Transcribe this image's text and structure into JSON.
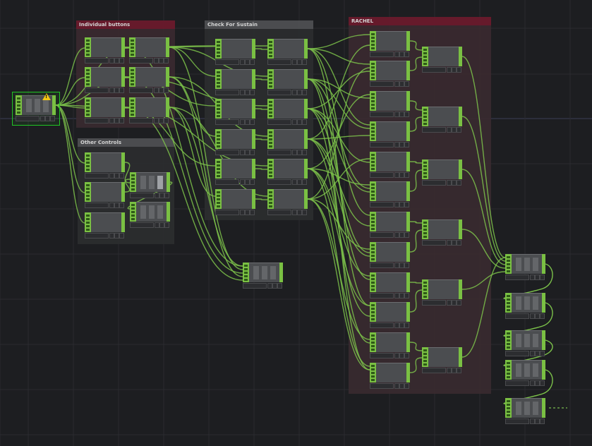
{
  "app": "TouchDesigner network editor",
  "boxes": [
    {
      "id": "individual-buttons",
      "title": "Individual buttons",
      "color": "#6e1a2d",
      "body": "#3a2a30"
    },
    {
      "id": "check-for-sustain",
      "title": "Check For Sustain",
      "color": "#505254",
      "body": "#2c2d2f"
    },
    {
      "id": "other-controls",
      "title": "Other Controls",
      "color": "#505254",
      "body": "#2c2d2f"
    },
    {
      "id": "rachel",
      "title": "RACHEL",
      "color": "#6e1a2d",
      "body": "#3a2a30"
    }
  ],
  "nodes": [
    {
      "id": "joystick1",
      "label": "joystick1",
      "value": "",
      "kind": "joystick"
    },
    {
      "id": "select3",
      "label": "select3",
      "value": "0 butt"
    },
    {
      "id": "select1",
      "label": "select1",
      "value": "0 butt"
    },
    {
      "id": "select2",
      "label": "select2",
      "value": "0 butt"
    },
    {
      "id": "select5",
      "label": "select5",
      "value": "0 butt"
    },
    {
      "id": "select4",
      "label": "select4",
      "value": "0 butt"
    },
    {
      "id": "select6",
      "label": "select6",
      "value": "0 butt"
    },
    {
      "id": "trigger1",
      "label": "trigger1",
      "value": "0 butt"
    },
    {
      "id": "trigger2",
      "label": "trigger2",
      "value": "0 butt"
    },
    {
      "id": "trigger3",
      "label": "trigger3",
      "value": "0 butt"
    },
    {
      "id": "trigger4",
      "label": "trigger4",
      "value": "0 butt"
    },
    {
      "id": "trigger5",
      "label": "trigger5",
      "value": "0 butt"
    },
    {
      "id": "trigger6",
      "label": "trigger6",
      "value": "0 butt"
    },
    {
      "id": "is_button1",
      "label": "is_button1_held",
      "value": "0 butt"
    },
    {
      "id": "is_button2",
      "label": "is_button2_held",
      "value": "0 butt"
    },
    {
      "id": "is_button3",
      "label": "is_button3_held",
      "value": "0 butt"
    },
    {
      "id": "is_button4",
      "label": "is_button4_held",
      "value": "0 butt"
    },
    {
      "id": "is_button5",
      "label": "is_button5_held",
      "value": "0 butt"
    },
    {
      "id": "is_button6",
      "label": "is_button6_held",
      "value": "0 butt"
    },
    {
      "id": "joystick_select",
      "label": "joystick_select",
      "value": "0 joys\n0 joys"
    },
    {
      "id": "strummer",
      "label": "strummer_select",
      "value": "0 stum"
    },
    {
      "id": "tilt",
      "label": "tilt",
      "value": "0 tilt"
    },
    {
      "id": "fan1",
      "label": "fan1",
      "value": "",
      "kind": "bars"
    },
    {
      "id": "rename1",
      "label": "rename1",
      "value": "",
      "kind": "bars"
    },
    {
      "id": "merge2",
      "label": "merge2",
      "value": "",
      "kind": "bars"
    },
    {
      "id": "logic1",
      "label": "logic1",
      "value": "0 butt"
    },
    {
      "id": "logic4",
      "label": "logic4",
      "value": "1 butt"
    },
    {
      "id": "logic3",
      "label": "logic3",
      "value": "0 butt"
    },
    {
      "id": "logic2",
      "label": "logic2",
      "value": "1 butt"
    },
    {
      "id": "logic5",
      "label": "logic5",
      "value": "0 butt"
    },
    {
      "id": "logic6",
      "label": "logic6",
      "value": "1 butt"
    },
    {
      "id": "logic7",
      "label": "logic7",
      "value": "0 butt"
    },
    {
      "id": "logic8",
      "label": "logic8",
      "value": "1 butt"
    },
    {
      "id": "logic9",
      "label": "logic9",
      "value": "0 butt"
    },
    {
      "id": "logic10",
      "label": "logic10",
      "value": "1 butt"
    },
    {
      "id": "logic11",
      "label": "logic11",
      "value": "0 butt"
    },
    {
      "id": "logic12",
      "label": "logic12",
      "value": "1 butt"
    },
    {
      "id": "or_r",
      "label": "r",
      "value": "0 butt"
    },
    {
      "id": "or_a",
      "label": "a",
      "value": "0 butt"
    },
    {
      "id": "or_c",
      "label": "c",
      "value": "0 butt"
    },
    {
      "id": "or_h",
      "label": "h",
      "value": "0 butt"
    },
    {
      "id": "or_e",
      "label": "e",
      "value": "0 butt"
    },
    {
      "id": "or_l",
      "label": "l",
      "value": "0 butt"
    },
    {
      "id": "merge1",
      "label": "merge1",
      "value": "",
      "kind": "bars"
    },
    {
      "id": "rename2",
      "label": "rename2",
      "value": "",
      "kind": "bars"
    },
    {
      "id": "letter_select",
      "label": "letter_select",
      "value": "",
      "kind": "bars"
    },
    {
      "id": "delay1",
      "label": "delay1",
      "value": "",
      "kind": "bars"
    },
    {
      "id": "out1",
      "label": "out1",
      "value": "",
      "kind": "bars"
    }
  ],
  "colors": {
    "wire": "#7cc24a",
    "node_green": "#7ac043",
    "background": "#1d1e21",
    "grid_line": "#2a2b2f",
    "selection": "#21c624",
    "warning": "#f3c614"
  },
  "icons": {
    "warning": "warning-icon"
  }
}
